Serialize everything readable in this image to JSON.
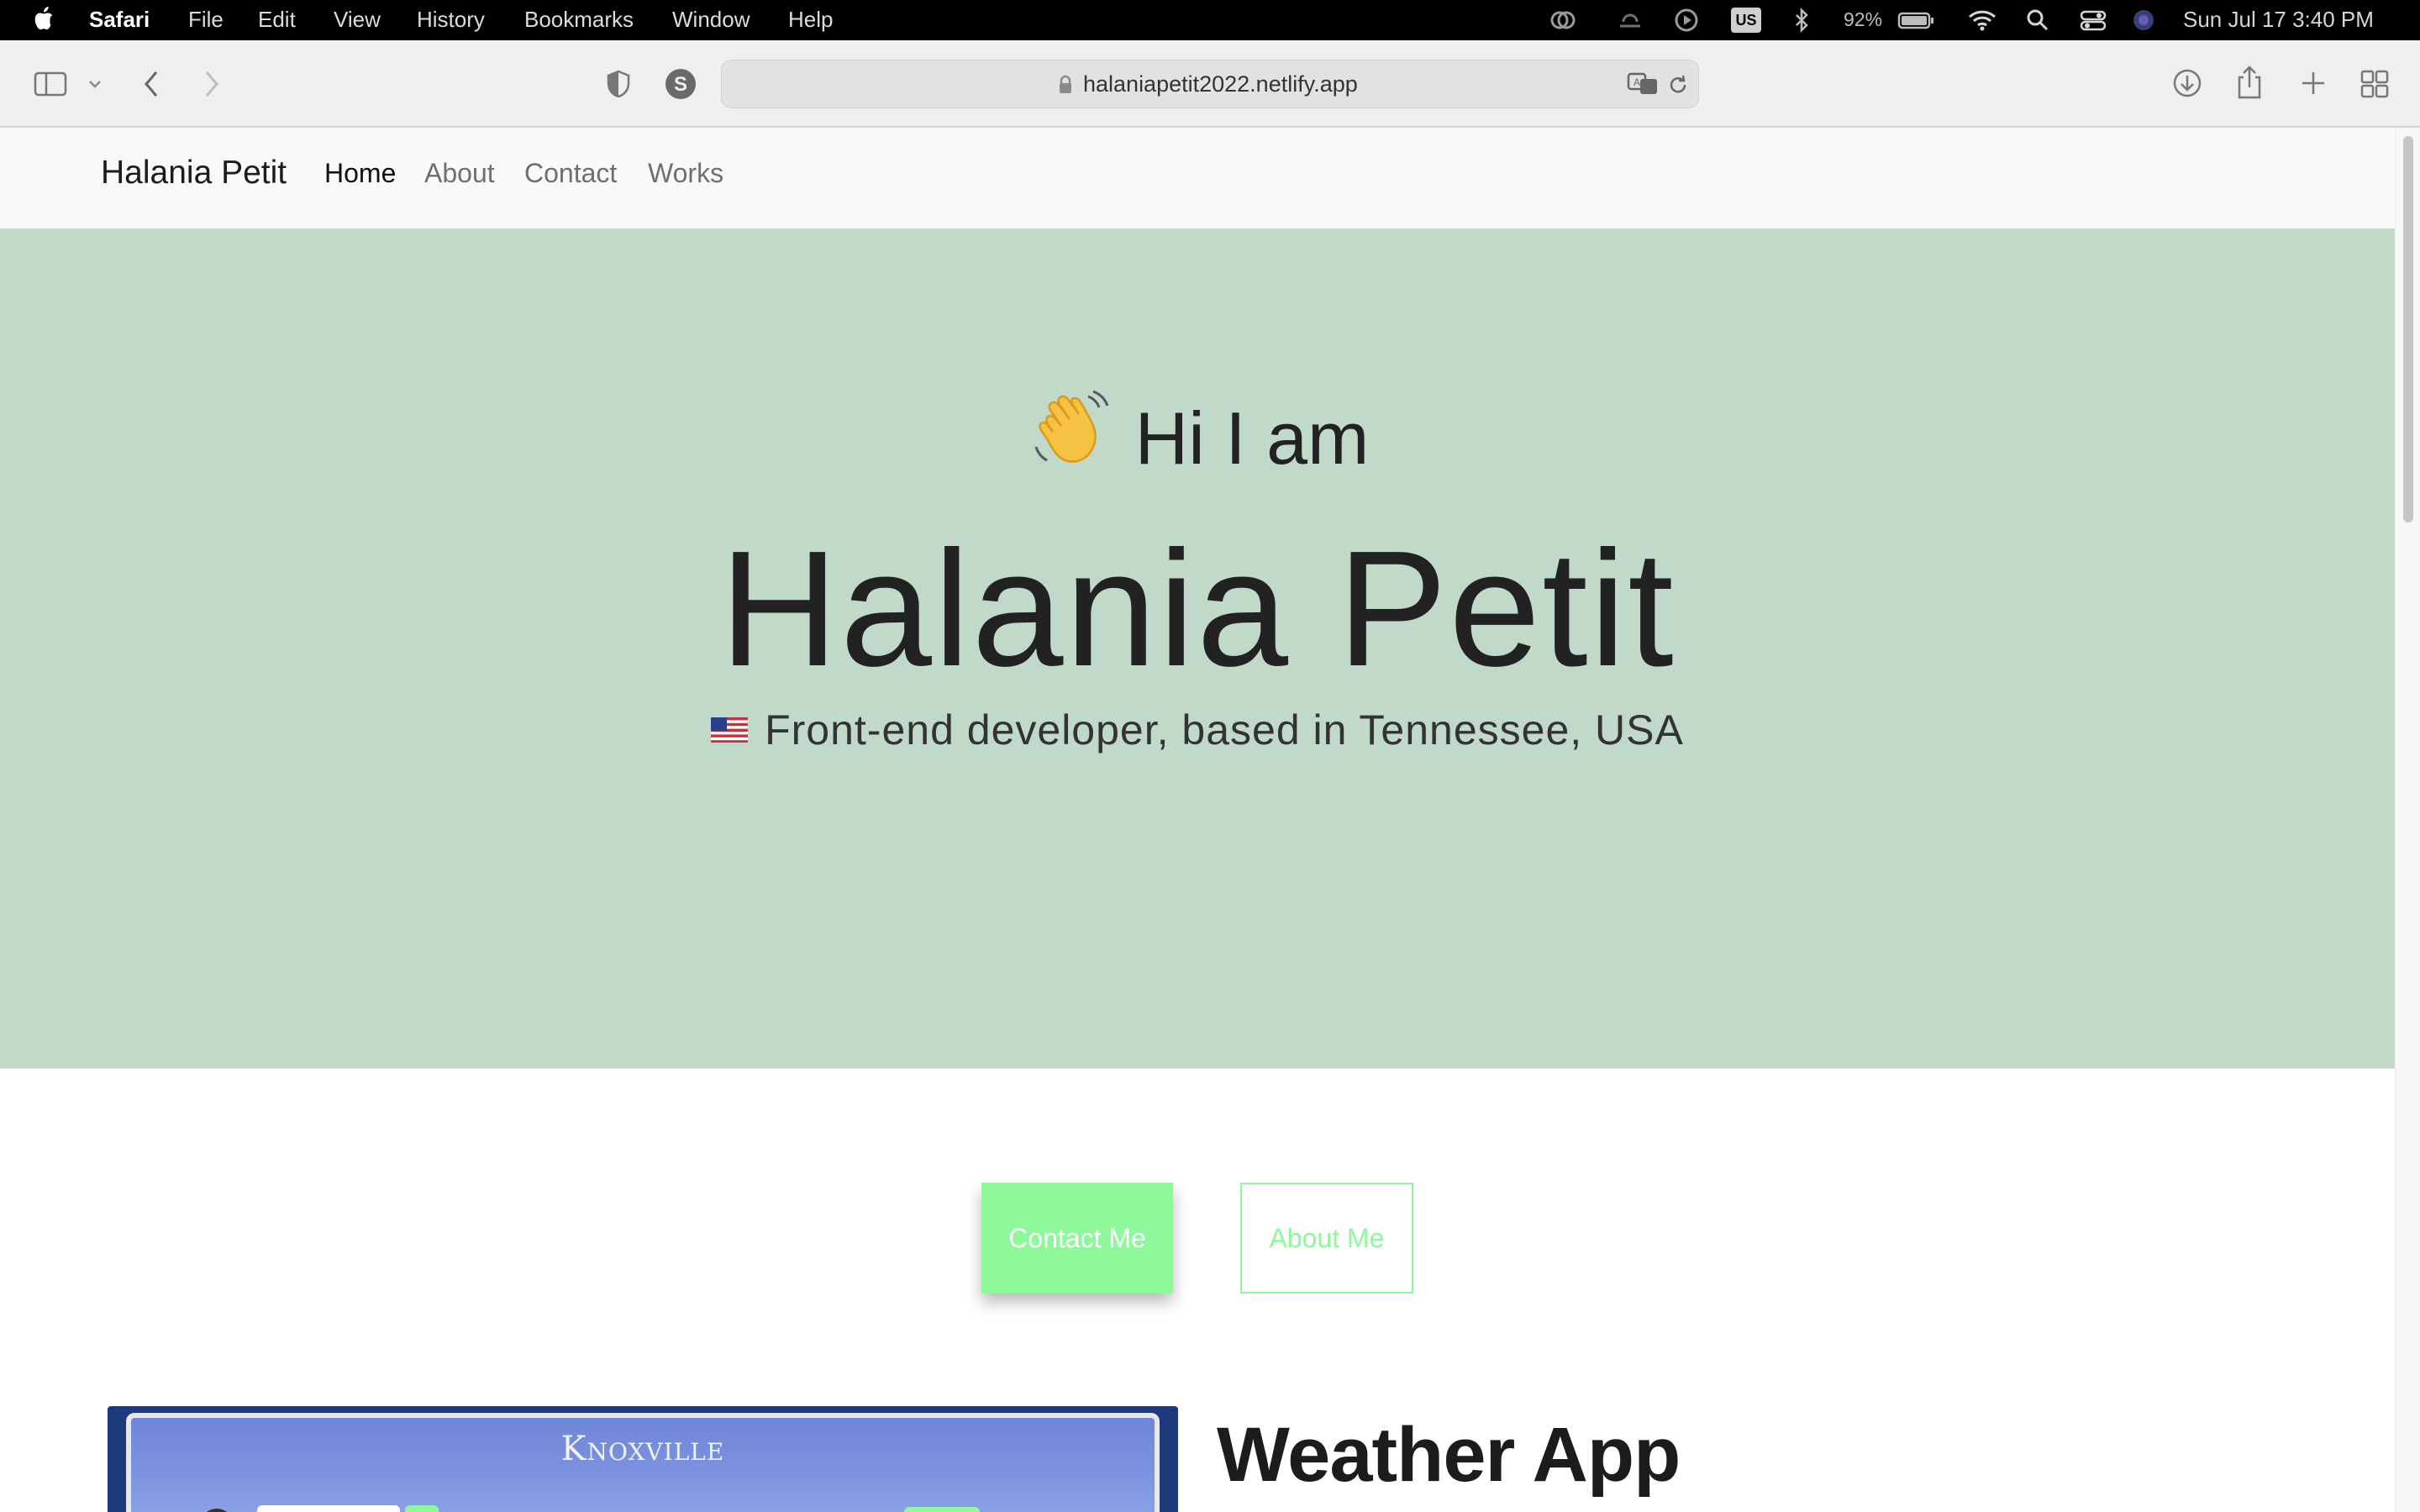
{
  "menubar": {
    "app_name": "Safari",
    "menus": [
      "File",
      "Edit",
      "View",
      "History",
      "Bookmarks",
      "Window",
      "Help"
    ],
    "status": {
      "battery": "92%",
      "keyboard": "US",
      "datetime": "Sun Jul 17  3:40 PM"
    }
  },
  "browser": {
    "url": "halaniapetit2022.netlify.app"
  },
  "site": {
    "brand": "Halania Petit",
    "nav": [
      "Home",
      "About",
      "Contact",
      "Works"
    ],
    "hero": {
      "greeting": "Hi I am",
      "name": "Halania Petit",
      "subtitle": "Front-end developer, based in Tennessee, USA"
    },
    "buttons": {
      "contact": "Contact Me",
      "about": "About Me"
    },
    "project": {
      "title": "Weather App",
      "thumbnail_city": "Knoxville"
    }
  },
  "colors": {
    "hero_bg": "#c0d9c8",
    "accent_green": "#8ef99b",
    "nav_bg": "#f8f9fa"
  }
}
